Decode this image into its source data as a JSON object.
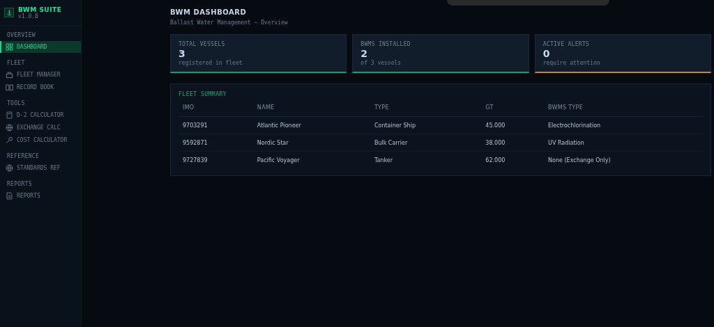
{
  "brand": {
    "title": "BWM SUITE",
    "version": "v1.0.0"
  },
  "sidebar": {
    "sections": [
      {
        "label": "OVERVIEW",
        "items": [
          {
            "label": "DASHBOARD",
            "selected": true
          }
        ]
      },
      {
        "label": "FLEET",
        "items": [
          {
            "label": "FLEET MANAGER",
            "selected": false
          },
          {
            "label": "RECORD BOOK",
            "selected": false
          }
        ]
      },
      {
        "label": "TOOLS",
        "items": [
          {
            "label": "D-2 CALCULATOR",
            "selected": false
          },
          {
            "label": "EXCHANGE CALC",
            "selected": false
          },
          {
            "label": "COST CALCULATOR",
            "selected": false
          }
        ]
      },
      {
        "label": "REFERENCE",
        "items": [
          {
            "label": "STANDARDS REF",
            "selected": false
          }
        ]
      },
      {
        "label": "REPORTS",
        "items": [
          {
            "label": "REPORTS",
            "selected": false
          }
        ]
      }
    ]
  },
  "page": {
    "title": "BWM DASHBOARD",
    "subtitle": "Ballast Water Management — Overview"
  },
  "stats": [
    {
      "label": "TOTAL VESSELS",
      "value": "3",
      "note": "registered in fleet",
      "color": "#10a37a"
    },
    {
      "label": "BWMS INSTALLED",
      "value": "2",
      "note": "of 3 vessels",
      "color": "#10a37a"
    },
    {
      "label": "ACTIVE ALERTS",
      "value": "0",
      "note": "require attention",
      "color": "#c8862a"
    }
  ],
  "table": {
    "title": "FLEET SUMMARY",
    "columns": [
      "IMO",
      "NAME",
      "TYPE",
      "GT",
      "BWMS TYPE"
    ],
    "rows": [
      [
        "9703291",
        "Atlantic Pioneer",
        "Container Ship",
        "45.000",
        "Electrochlorination"
      ],
      [
        "9592871",
        "Nordic Star",
        "Bulk Carrier",
        "38.000",
        "UV Radiation"
      ],
      [
        "9727839",
        "Pacific Voyager",
        "Tanker",
        "62.000",
        "None (Exchange Only)"
      ]
    ]
  }
}
